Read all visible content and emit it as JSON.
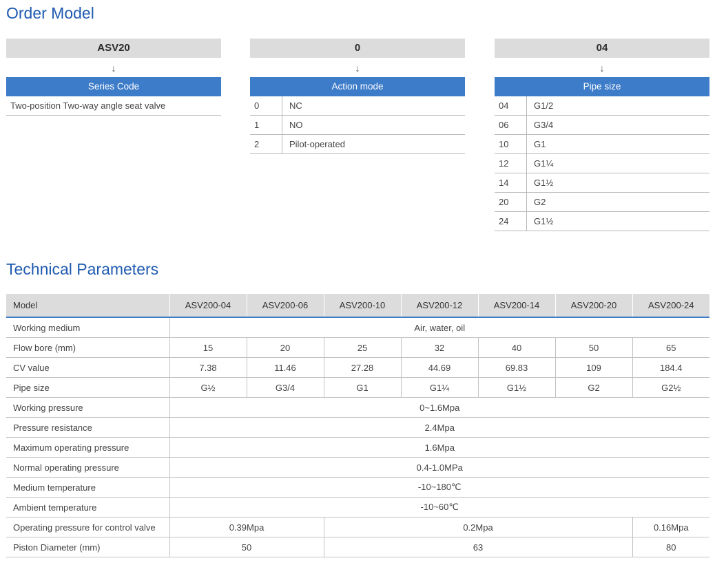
{
  "order_model": {
    "title": "Order Model",
    "series": {
      "header": "ASV20",
      "arrow": "↓",
      "band": "Series Code",
      "rows": [
        {
          "desc": "Two-position Two-way angle seat valve"
        }
      ]
    },
    "action": {
      "header": "0",
      "arrow": "↓",
      "band": "Action mode",
      "rows": [
        {
          "code": "0",
          "desc": "NC"
        },
        {
          "code": "1",
          "desc": "NO"
        },
        {
          "code": "2",
          "desc": "Pilot-operated"
        }
      ]
    },
    "pipe": {
      "header": "04",
      "arrow": "↓",
      "band": "Pipe size",
      "rows": [
        {
          "code": "04",
          "desc": "G1/2"
        },
        {
          "code": "06",
          "desc": "G3/4"
        },
        {
          "code": "10",
          "desc": "G1"
        },
        {
          "code": "12",
          "desc": "G1¼"
        },
        {
          "code": "14",
          "desc": "G1½"
        },
        {
          "code": "20",
          "desc": "G2"
        },
        {
          "code": "24",
          "desc": "G1½"
        }
      ]
    }
  },
  "tech": {
    "title": "Technical Parameters",
    "header": [
      "Model",
      "ASV200-04",
      "ASV200-06",
      "ASV200-10",
      "ASV200-12",
      "ASV200-14",
      "ASV200-20",
      "ASV200-24"
    ],
    "rows": [
      {
        "label": "Working medium",
        "cells": [
          {
            "v": "Air, water, oil",
            "span": 7
          }
        ]
      },
      {
        "label": "Flow bore  (mm)",
        "cells": [
          {
            "v": "15"
          },
          {
            "v": "20"
          },
          {
            "v": "25"
          },
          {
            "v": "32"
          },
          {
            "v": "40"
          },
          {
            "v": "50"
          },
          {
            "v": "65"
          }
        ]
      },
      {
        "label": "CV  value",
        "cells": [
          {
            "v": "7.38"
          },
          {
            "v": "11.46"
          },
          {
            "v": "27.28"
          },
          {
            "v": "44.69"
          },
          {
            "v": "69.83"
          },
          {
            "v": "109"
          },
          {
            "v": "184.4"
          }
        ]
      },
      {
        "label": "Pipe size",
        "cells": [
          {
            "v": "G½"
          },
          {
            "v": "G3/4"
          },
          {
            "v": "G1"
          },
          {
            "v": "G1¼"
          },
          {
            "v": "G1½"
          },
          {
            "v": "G2"
          },
          {
            "v": "G2½"
          }
        ]
      },
      {
        "label": "Working pressure",
        "cells": [
          {
            "v": "0~1.6Mpa",
            "span": 7
          }
        ]
      },
      {
        "label": "Pressure resistance",
        "cells": [
          {
            "v": "2.4Mpa",
            "span": 7
          }
        ]
      },
      {
        "label": "Maximum operating pressure",
        "cells": [
          {
            "v": "1.6Mpa",
            "span": 7
          }
        ]
      },
      {
        "label": "Normal  operating pressure",
        "cells": [
          {
            "v": "0.4-1.0MPa",
            "span": 7
          }
        ]
      },
      {
        "label": "Medium temperature",
        "cells": [
          {
            "v": "-10~180℃",
            "span": 7
          }
        ]
      },
      {
        "label": "Ambient temperature",
        "cells": [
          {
            "v": "-10~60℃",
            "span": 7
          }
        ]
      },
      {
        "label": "Operating pressure for control valve",
        "cells": [
          {
            "v": "0.39Mpa",
            "span": 2
          },
          {
            "v": "0.2Mpa",
            "span": 4
          },
          {
            "v": "0.16Mpa",
            "span": 1
          }
        ]
      },
      {
        "label": "Piston Diameter (mm)",
        "cells": [
          {
            "v": "50",
            "span": 2
          },
          {
            "v": "63",
            "span": 4
          },
          {
            "v": "80",
            "span": 1
          }
        ]
      }
    ]
  },
  "colors": {
    "accent_blue": "#3d7cc9",
    "title_blue": "#1f5bb0",
    "header_gray": "#dcdcdc"
  }
}
